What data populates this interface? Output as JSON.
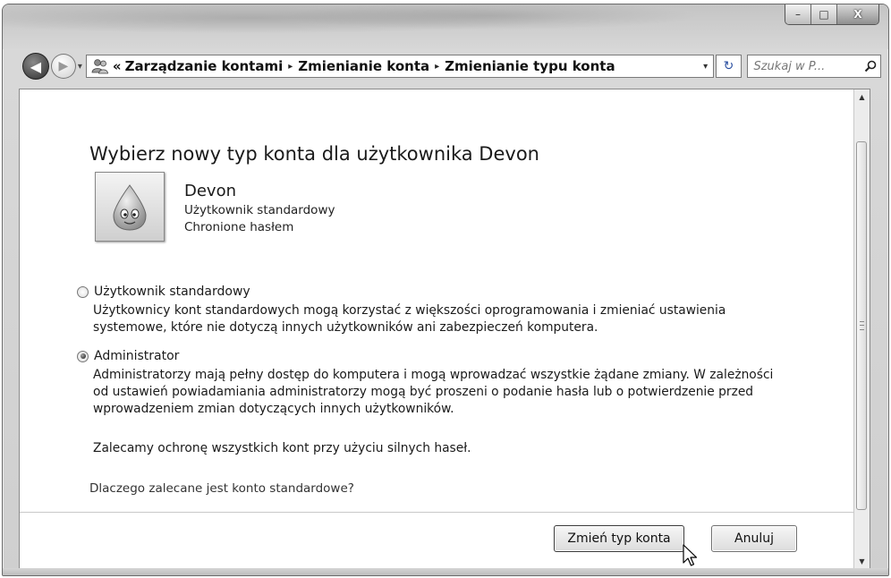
{
  "window": {
    "caption_minimize": "–",
    "caption_maximize": "□",
    "caption_close": "X"
  },
  "navbar": {
    "back_glyph": "◀",
    "forward_glyph": "▶",
    "history_dropdown_glyph": "▾",
    "breadcrumb_overflow": "«",
    "breadcrumb_separator": "▸",
    "breadcrumbs": [
      "Zarządzanie kontami",
      "Zmienianie konta",
      "Zmienianie typu konta"
    ],
    "address_dropdown_glyph": "▾",
    "refresh_glyph": "↻",
    "search_placeholder": "Szukaj w P...",
    "icons": {
      "address": "users-control-panel-icon",
      "search": "search-icon"
    }
  },
  "main": {
    "title": "Wybierz nowy typ konta dla użytkownika Devon",
    "user": {
      "name": "Devon",
      "account_type": "Użytkownik standardowy",
      "password_status": "Chronione hasłem",
      "avatar_icon": "user-avatar-picture"
    },
    "options": [
      {
        "label": "Użytkownik standardowy",
        "checked": false,
        "description": "Użytkownicy kont standardowych mogą korzystać z większości oprogramowania i zmieniać ustawienia systemowe, które nie dotyczą innych użytkowników ani zabezpieczeń komputera."
      },
      {
        "label": "Administrator",
        "checked": true,
        "description": "Administratorzy mają pełny dostęp do komputera i mogą wprowadzać wszystkie żądane zmiany. W zależności od ustawień powiadamiania administratorzy mogą być proszeni o podanie hasła lub o potwierdzenie przed wprowadzeniem zmian dotyczących innych użytkowników."
      }
    ],
    "recommendation": "Zalecamy ochronę wszystkich kont przy użyciu silnych haseł.",
    "help_link": "Dlaczego zalecane jest konto standardowe?"
  },
  "footer": {
    "primary_button": "Zmień typ konta",
    "cancel_button": "Anuluj"
  },
  "scrollbar": {
    "up_glyph": "▲",
    "down_glyph": "▼"
  },
  "colors": {
    "window_frame": "#cfcfcf",
    "content_background": "#ffffff",
    "text": "#1a1a1a"
  }
}
